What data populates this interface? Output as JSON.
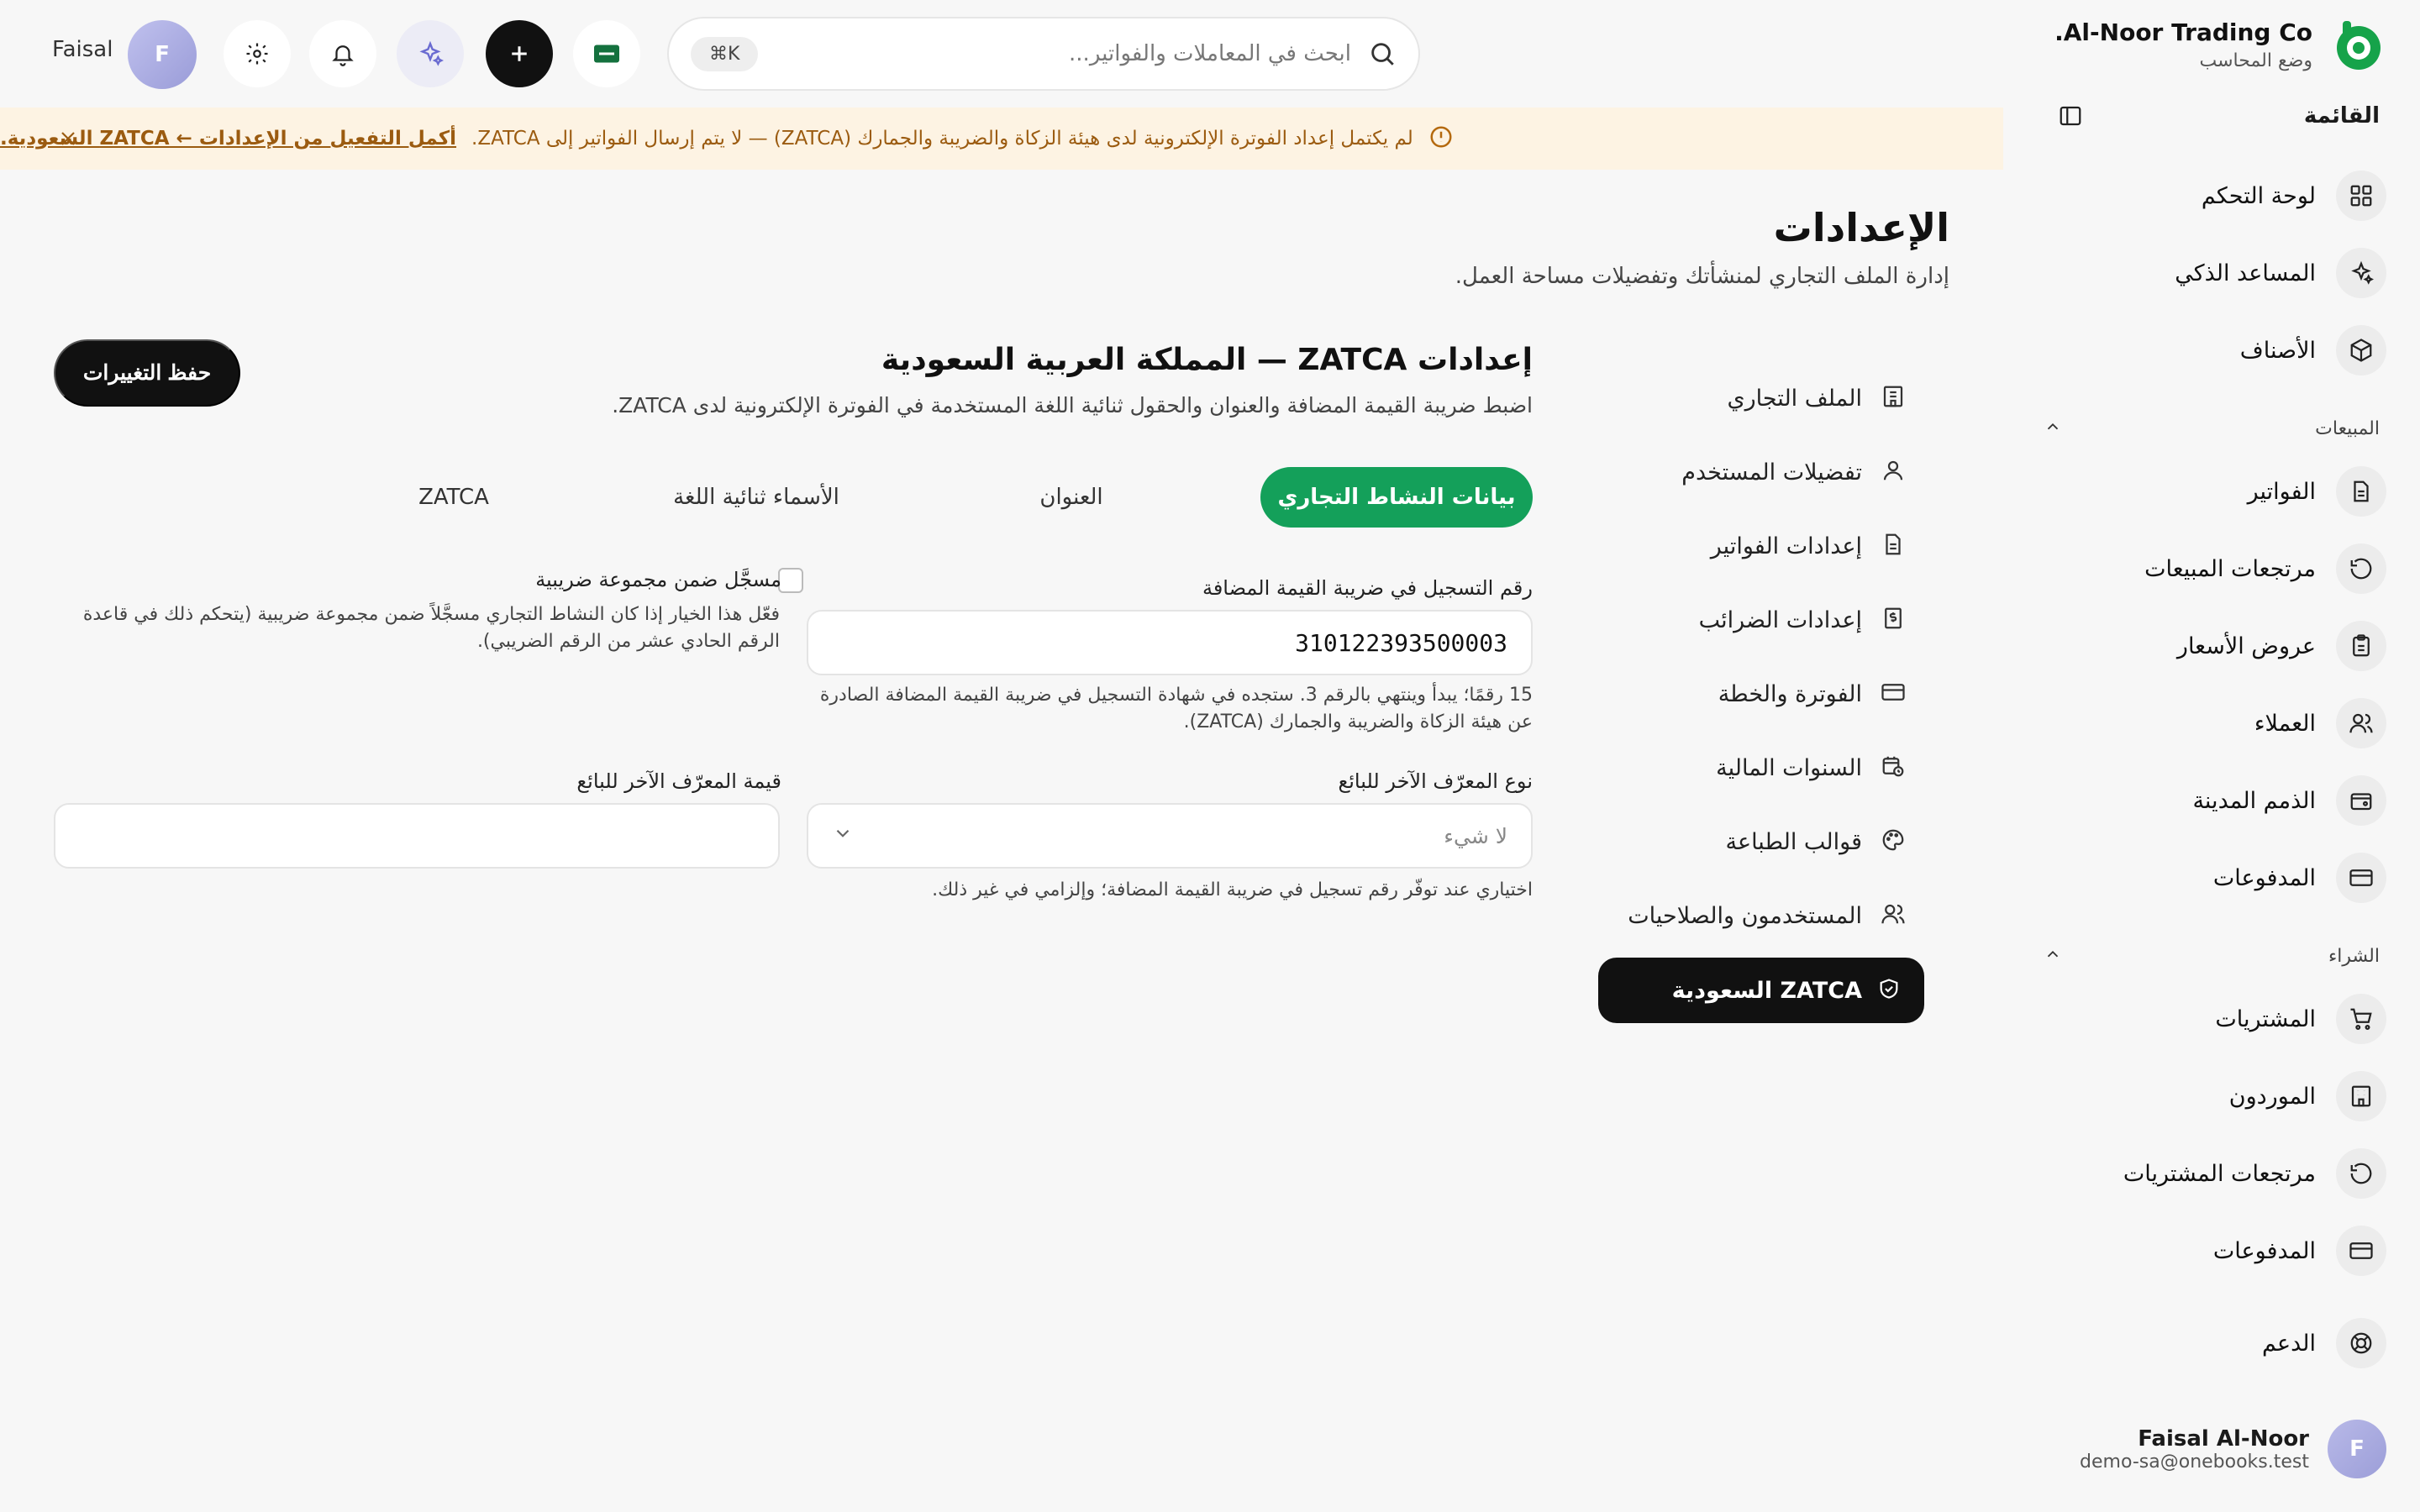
{
  "brand": {
    "name": "Al-Noor Trading Co.",
    "mode": "وضع المحاسب"
  },
  "sidebar": {
    "menu_label": "القائمة",
    "items_top": [
      "لوحة التحكم",
      "المساعد الذكي",
      "الأصناف"
    ],
    "sales_label": "المبيعات",
    "sales_items": [
      "الفواتير",
      "مرتجعات المبيعات",
      "عروض الأسعار",
      "العملاء",
      "الذمم المدينة",
      "المدفوعات"
    ],
    "purchase_label": "الشراء",
    "purchase_items": [
      "المشتريات",
      "الموردون",
      "مرتجعات المشتريات",
      "المدفوعات"
    ],
    "support": "الدعم",
    "user": {
      "initial": "F",
      "name": "Faisal Al-Noor",
      "email": "demo-sa@onebooks.test"
    }
  },
  "topbar": {
    "search_placeholder": "ابحث في المعاملات والفواتير...",
    "shortcut": "⌘K",
    "user_initial": "F",
    "user_name": "Faisal"
  },
  "banner": {
    "text": "لم يكتمل إعداد الفوترة الإلكترونية لدى هيئة الزكاة والضريبة والجمارك (ZATCA) — لا يتم إرسال الفواتير إلى ZATCA.",
    "link": "أكمل التفعيل من الإعدادات ← ZATCA السعودية."
  },
  "page": {
    "title": "الإعدادات",
    "subtitle": "إدارة الملف التجاري لمنشأتك وتفضيلات مساحة العمل."
  },
  "settings_nav": [
    "الملف التجاري",
    "تفضيلات المستخدم",
    "إعدادات الفواتير",
    "إعدادات الضرائب",
    "الفوترة والخطة",
    "السنوات المالية",
    "قوالب الطباعة",
    "المستخدمون والصلاحيات"
  ],
  "settings_nav_active": "ZATCA السعودية",
  "panel": {
    "title": "إعدادات ZATCA — المملكة العربية السعودية",
    "subtitle": "اضبط ضريبة القيمة المضافة والعنوان والحقول ثنائية اللغة المستخدمة في الفوترة الإلكترونية لدى ZATCA.",
    "save": "حفظ التغييرات",
    "tabs": [
      "بيانات النشاط التجاري",
      "العنوان",
      "الأسماء ثنائية اللغة",
      "ZATCA"
    ],
    "vat_label": "رقم التسجيل في ضريبة القيمة المضافة",
    "vat_value": "310122393500003",
    "vat_help": "15 رقمًا؛ يبدأ وينتهي بالرقم 3. ستجده في شهادة التسجيل في ضريبة القيمة المضافة الصادرة عن هيئة الزكاة والضريبة والجمارك (ZATCA).",
    "group_label": "مسجَّل ضمن مجموعة ضريبية",
    "group_help": "فعّل هذا الخيار إذا كان النشاط التجاري مسجَّلاً ضمن مجموعة ضريبية (يتحكم ذلك في قاعدة الرقم الحادي عشر من الرقم الضريبي).",
    "other_id_type_label": "نوع المعرّف الآخر للبائع",
    "other_id_type_value": "لا شيء",
    "other_id_type_help": "اختياري عند توفّر رقم تسجيل في ضريبة القيمة المضافة؛ وإلزامي في غير ذلك.",
    "other_id_value_label": "قيمة المعرّف الآخر للبائع",
    "other_id_value": ""
  },
  "colors": {
    "accent": "#14a05a",
    "banner_bg": "#fdf3e3",
    "banner_text": "#9b5b10",
    "dark": "#111111"
  }
}
